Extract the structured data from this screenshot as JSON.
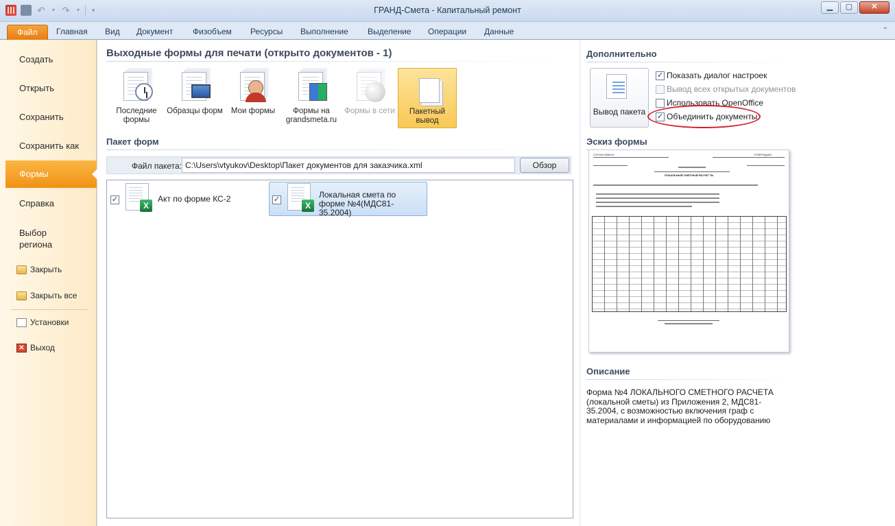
{
  "window": {
    "title": "ГРАНД-Смета - Капитальный ремонт"
  },
  "ribbon": {
    "tabs": [
      "Файл",
      "Главная",
      "Вид",
      "Документ",
      "Физобъем",
      "Ресурсы",
      "Выполнение",
      "Выделение",
      "Операции",
      "Данные"
    ]
  },
  "leftnav": {
    "items": [
      "Создать",
      "Открыть",
      "Сохранить",
      "Сохранить как",
      "Формы",
      "Справка",
      "Выбор\nрегиона"
    ],
    "small": [
      "Закрыть",
      "Закрыть все",
      "Установки",
      "Выход"
    ]
  },
  "main": {
    "title": "Выходные формы для печати (открыто документов - 1)",
    "form_buttons": [
      {
        "label": "Последние формы",
        "icon": "clock-icon",
        "state": "normal"
      },
      {
        "label": "Образцы форм",
        "icon": "monitor-icon",
        "state": "normal"
      },
      {
        "label": "Мои формы",
        "icon": "user-icon",
        "state": "normal"
      },
      {
        "label": "Формы на grandsmeta.ru",
        "icon": "blocks-icon",
        "state": "normal"
      },
      {
        "label": "Формы в сети",
        "icon": "globe-icon",
        "state": "disabled"
      },
      {
        "label": "Пакетный вывод",
        "icon": "stack-icon",
        "state": "selected"
      }
    ],
    "packet_section": "Пакет форм",
    "file_label": "Файл пакета:",
    "file_value": "C:\\Users\\vtyukov\\Desktop\\Пакет документов для заказчика.xml",
    "browse": "Обзор",
    "forms": [
      {
        "label": "Акт по форме КС-2",
        "checked": true
      },
      {
        "label": "Локальная смета по форме №4(МДС81-35.2004)",
        "checked": true
      }
    ]
  },
  "right": {
    "additional_title": "Дополнительно",
    "output_button": "Вывод пакета",
    "options": [
      {
        "label": "Показать диалог настроек",
        "checked": true,
        "disabled": false
      },
      {
        "label": "Вывод всех открытых документов",
        "checked": false,
        "disabled": true
      },
      {
        "label": "Использовать OpenOffice",
        "checked": false,
        "disabled": false
      },
      {
        "label": "Объединить документы",
        "checked": true,
        "disabled": false
      }
    ],
    "sketch_title": "Эскиз формы",
    "preview": {
      "header_left": "СОГЛАСОВАНО:",
      "header_right": "УТВЕРЖДАЮ:",
      "doc_title": "ЛОКАЛЬНЫЙ СМЕТНЫЙ РАСЧЕТ №"
    },
    "description_title": "Описание",
    "description": "Форма №4 ЛОКАЛЬНОГО СМЕТНОГО РАСЧЕТА (локальной сметы) из Приложения 2, МДС81-35.2004, с возможностью включения граф с материалами и информацией по оборудованию"
  },
  "colors": {
    "file_tab": "#e57e12",
    "nav_selected": "#f09215",
    "highlight": "#d0202a"
  }
}
